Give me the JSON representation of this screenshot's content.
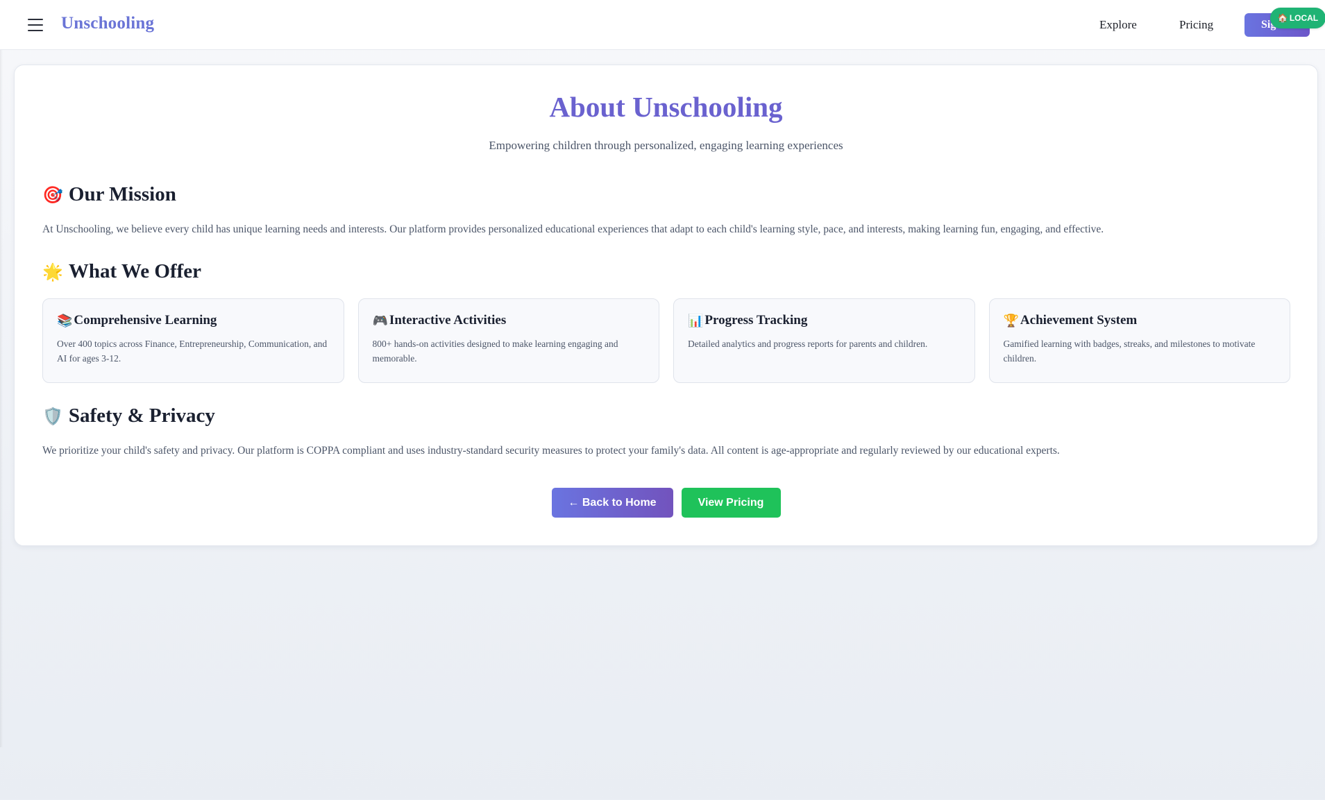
{
  "header": {
    "brand": "Unschooling",
    "nav": {
      "explore": "Explore",
      "pricing": "Pricing"
    },
    "signup_label": "Sign",
    "local_badge": "LOCAL",
    "local_badge_icon": "🏠"
  },
  "about": {
    "title": "About Unschooling",
    "subtitle": "Empowering children through personalized, engaging learning experiences",
    "mission": {
      "icon": "🎯",
      "heading": "Our Mission",
      "text": "At Unschooling, we believe every child has unique learning needs and interests. Our platform provides personalized educational experiences that adapt to each child's learning style, pace, and interests, making learning fun, engaging, and effective."
    },
    "offer": {
      "icon": "🌟",
      "heading": "What We Offer",
      "items": [
        {
          "icon": "📚",
          "title": "Comprehensive Learning",
          "desc": "Over 400 topics across Finance, Entrepreneurship, Communication, and AI for ages 3-12."
        },
        {
          "icon": "🎮",
          "title": "Interactive Activities",
          "desc": "800+ hands-on activities designed to make learning engaging and memorable."
        },
        {
          "icon": "📊",
          "title": "Progress Tracking",
          "desc": "Detailed analytics and progress reports for parents and children."
        },
        {
          "icon": "🏆",
          "title": "Achievement System",
          "desc": "Gamified learning with badges, streaks, and milestones to motivate children."
        }
      ]
    },
    "safety": {
      "icon": "🛡️",
      "heading": "Safety & Privacy",
      "text": "We prioritize your child's safety and privacy. Our platform is COPPA compliant and uses industry-standard security measures to protect your family's data. All content is age-appropriate and regularly reviewed by our educational experts."
    },
    "buttons": {
      "home": "← Back to Home",
      "pricing": "View Pricing"
    }
  },
  "colors": {
    "brand": "#6a74d6",
    "title": "#6a62cf",
    "primary_button": "#6a74e0",
    "secondary_button": "#1fc25a",
    "badge": "#1fb374"
  }
}
